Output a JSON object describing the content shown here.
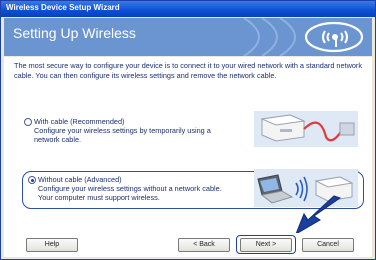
{
  "window": {
    "title": "Wireless Device Setup Wizard"
  },
  "header": {
    "title": "Setting Up Wireless",
    "logo": "wifi-logo"
  },
  "description": "The most secure way to configure your device is to connect it to your wired network with a standard network cable. You can then configure its wireless settings and remove the network cable.",
  "options": [
    {
      "label": "With cable (Recommended)",
      "text": "Configure your wireless settings by temporarily using a network cable.",
      "selected": false
    },
    {
      "label": "Without cable (Advanced)",
      "text": "Configure your wireless settings without a network cable. Your computer must support wireless.",
      "selected": true
    }
  ],
  "buttons": {
    "help": "Help",
    "back": "< Back",
    "next": "Next >",
    "cancel": "Cancel"
  },
  "colors": {
    "accent": "#1c3fa8",
    "header": "#6b95d0",
    "cable": "#e0393b"
  }
}
